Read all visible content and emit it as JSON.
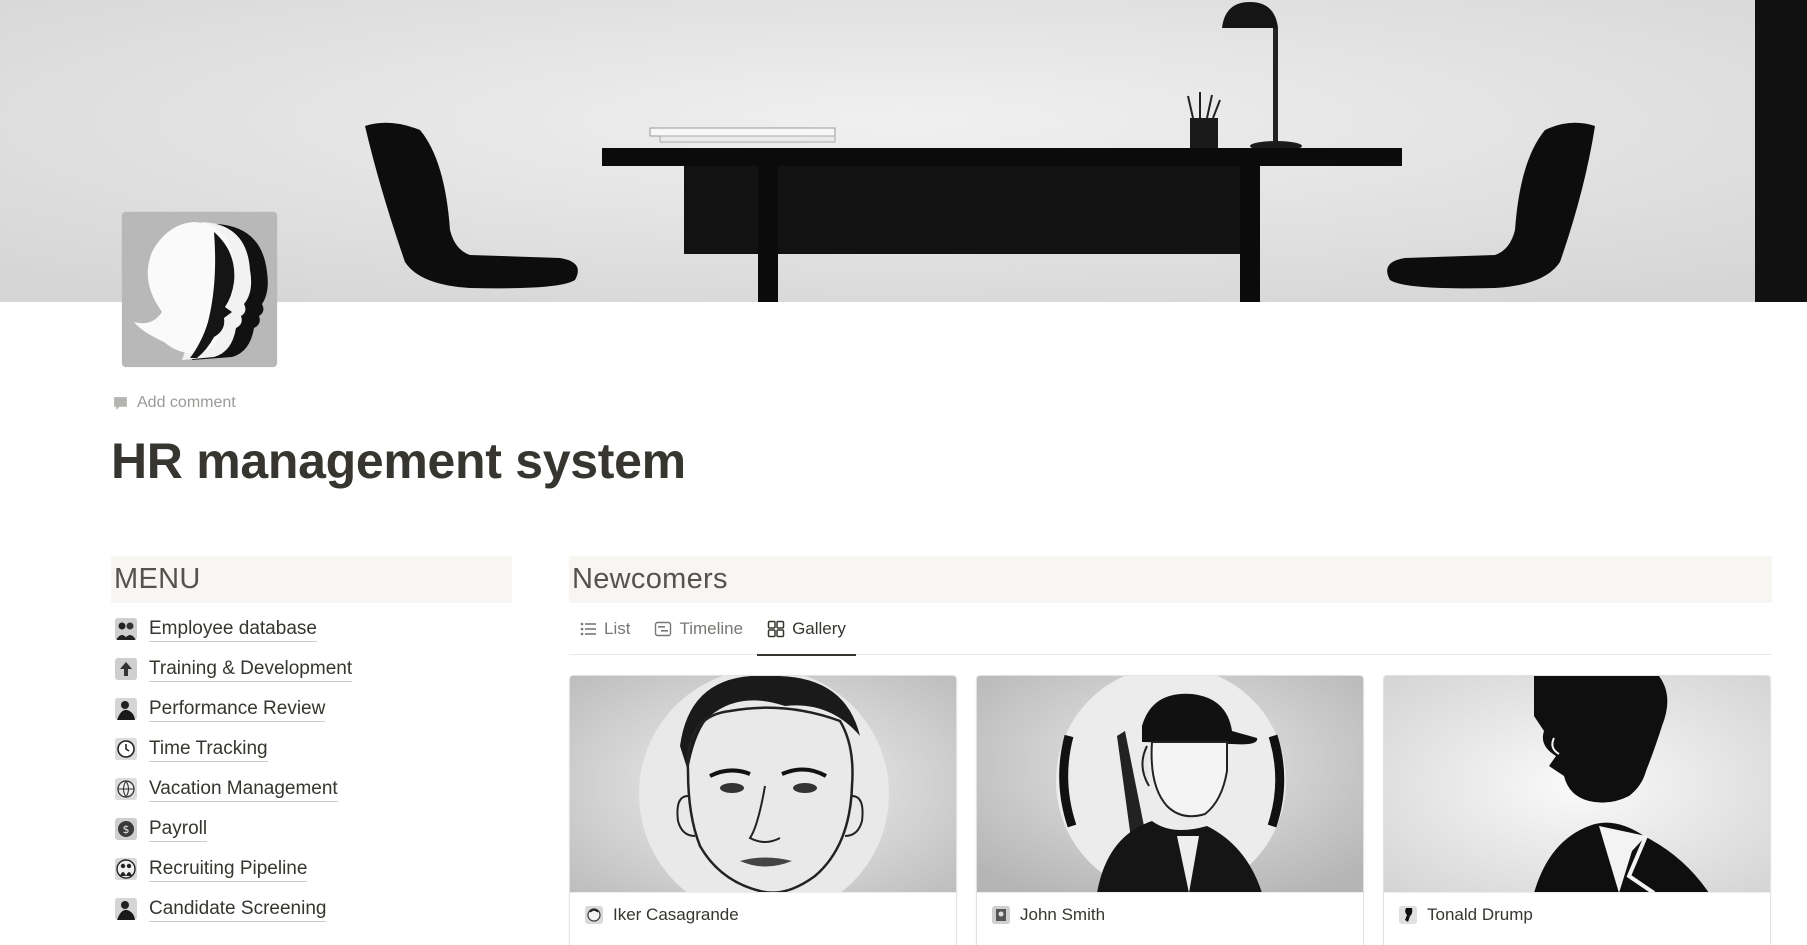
{
  "page": {
    "add_comment": "Add comment",
    "title": "HR management system"
  },
  "icons": {
    "page": "silhouette-heads-icon",
    "comment": "comment-icon"
  },
  "menu": {
    "heading": "MENU",
    "items": [
      {
        "label": "Employee database",
        "icon": "people-icon"
      },
      {
        "label": "Training & Development",
        "icon": "arrow-up-icon"
      },
      {
        "label": "Performance Review",
        "icon": "person-icon"
      },
      {
        "label": "Time Tracking",
        "icon": "clock-icon"
      },
      {
        "label": "Vacation Management",
        "icon": "globe-icon"
      },
      {
        "label": "Payroll",
        "icon": "dollar-coin-icon"
      },
      {
        "label": "Recruiting Pipeline",
        "icon": "group-icon"
      },
      {
        "label": "Candidate Screening",
        "icon": "person-icon"
      }
    ]
  },
  "newcomers": {
    "heading": "Newcomers",
    "tabs": [
      {
        "label": "List",
        "icon": "list-icon",
        "active": false
      },
      {
        "label": "Timeline",
        "icon": "timeline-icon",
        "active": false
      },
      {
        "label": "Gallery",
        "icon": "gallery-icon",
        "active": true
      }
    ],
    "cards": [
      {
        "name": "Iker Casagrande",
        "image": "portrait-face-illustration"
      },
      {
        "name": "John Smith",
        "image": "worker-helmet-illustration"
      },
      {
        "name": "Tonald Drump",
        "image": "bearded-silhouette-illustration"
      }
    ]
  },
  "colors": {
    "text": "#37352f",
    "muted": "#9b9a97",
    "header_bg": "#f7f6f3"
  }
}
